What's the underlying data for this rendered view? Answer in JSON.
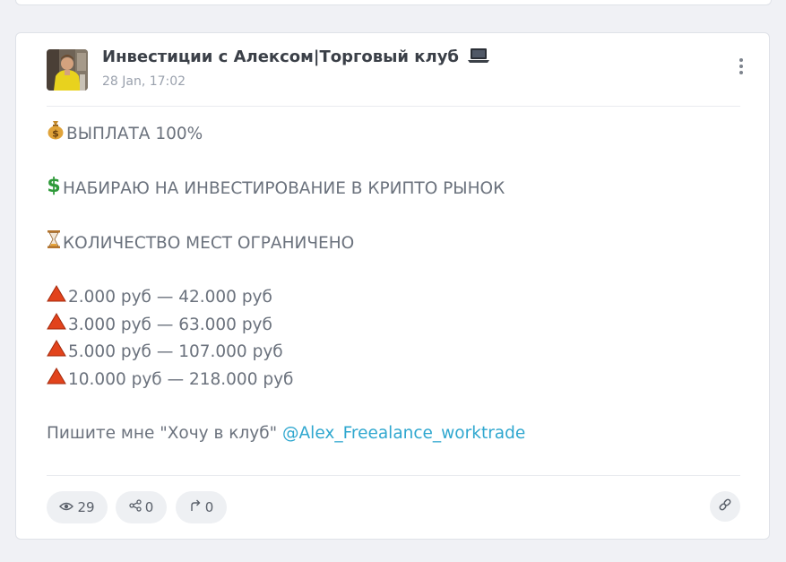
{
  "post": {
    "channel_name": "Инвестиции с Алексом|Торговый клуб",
    "channel_icon": "laptop-icon",
    "date": "28 Jan, 17:02",
    "lines": {
      "payout": "ВЫПЛАТА 100%",
      "recruiting": "НАБИРАЮ НА ИНВЕСТИРОВАНИЕ В КРИПТО РЫНОК",
      "limited": "КОЛИЧЕСТВО МЕСТ ОГРАНИЧЕНО",
      "tiers": [
        "2.000 руб — 42.000 руб",
        "3.000 руб — 63.000 руб",
        "5.000 руб — 107.000 руб",
        "10.000 руб — 218.000 руб"
      ],
      "cta": "Пишите мне \"Хочу в клуб\" ",
      "mention": "@Alex_Freealance_worktrade"
    },
    "emojis": {
      "payout": "money-bag-icon",
      "recruiting": "dollar-sign-icon",
      "limited": "hourglass-icon",
      "tier": "red-triangle-icon"
    }
  },
  "footer": {
    "views": "29",
    "shares": "0",
    "forwards": "0"
  },
  "colors": {
    "mention": "#2fa7cf",
    "text": "#6b727d",
    "title": "#3b4048"
  }
}
